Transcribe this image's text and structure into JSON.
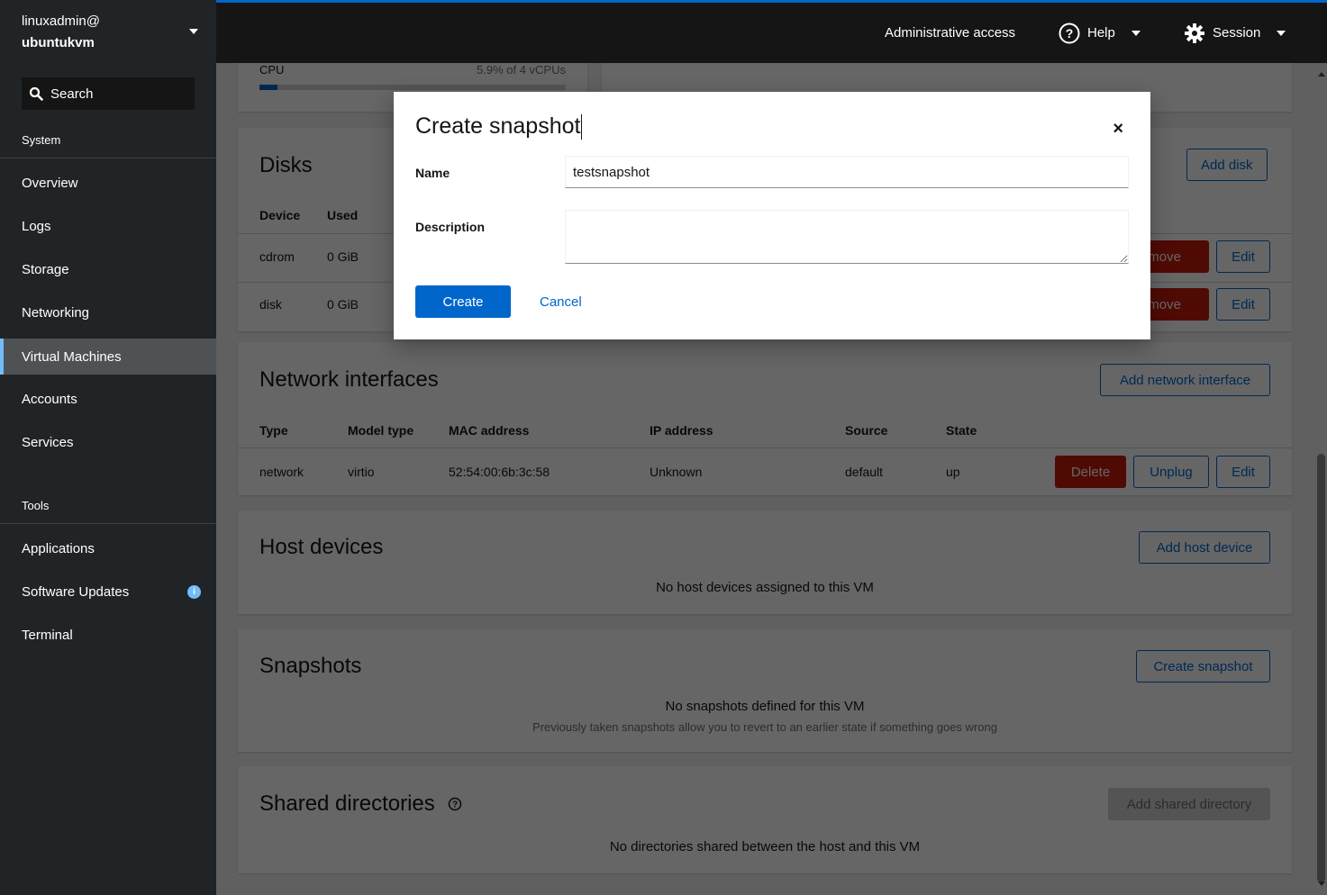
{
  "sidebar": {
    "user": "linuxadmin@",
    "host": "ubuntukvm",
    "search_label": "Search",
    "system_label": "System",
    "tools_label": "Tools",
    "system_items": [
      {
        "label": "Overview"
      },
      {
        "label": "Logs"
      },
      {
        "label": "Storage"
      },
      {
        "label": "Networking"
      },
      {
        "label": "Virtual Machines",
        "active": true
      },
      {
        "label": "Accounts"
      },
      {
        "label": "Services"
      }
    ],
    "tool_items": [
      {
        "label": "Applications"
      },
      {
        "label": "Software Updates",
        "badge": "i"
      },
      {
        "label": "Terminal"
      }
    ]
  },
  "topbar": {
    "admin_access": "Administrative access",
    "help": "Help",
    "session": "Session"
  },
  "usage": {
    "cpu_label": "CPU",
    "cpu_value": "5.9% of 4 vCPUs",
    "cpu_percent": 5.9
  },
  "disks": {
    "title": "Disks",
    "add_button": "Add disk",
    "columns": [
      "Device",
      "Used"
    ],
    "rows": [
      {
        "device": "cdrom",
        "used": "0 GiB",
        "remove": "Remove",
        "edit": "Edit"
      },
      {
        "device": "disk",
        "used": "0 GiB",
        "remove": "Remove",
        "edit": "Edit"
      }
    ]
  },
  "network": {
    "title": "Network interfaces",
    "add_button": "Add network interface",
    "columns": [
      "Type",
      "Model type",
      "MAC address",
      "IP address",
      "Source",
      "State"
    ],
    "rows": [
      {
        "type": "network",
        "model": "virtio",
        "mac": "52:54:00:6b:3c:58",
        "ip": "Unknown",
        "source": "default",
        "state": "up",
        "delete": "Delete",
        "unplug": "Unplug",
        "edit": "Edit"
      }
    ]
  },
  "host_devices": {
    "title": "Host devices",
    "add_button": "Add host device",
    "empty": "No host devices assigned to this VM"
  },
  "snapshots": {
    "title": "Snapshots",
    "create_button": "Create snapshot",
    "empty": "No snapshots defined for this VM",
    "empty_sub": "Previously taken snapshots allow you to revert to an earlier state if something goes wrong"
  },
  "shared_dirs": {
    "title": "Shared directories",
    "add_button": "Add shared directory",
    "empty": "No directories shared between the host and this VM"
  },
  "modal": {
    "title": "Create snapshot",
    "close": "×",
    "name_label": "Name",
    "name_value": "testsnapshot",
    "description_label": "Description",
    "description_value": "",
    "create_button": "Create",
    "cancel_button": "Cancel"
  },
  "colors": {
    "accent": "#0066cc",
    "danger": "#c9190b",
    "sidebar_bg": "#212427",
    "topbar_bg": "#151515",
    "active_marker": "#73bcf7"
  }
}
